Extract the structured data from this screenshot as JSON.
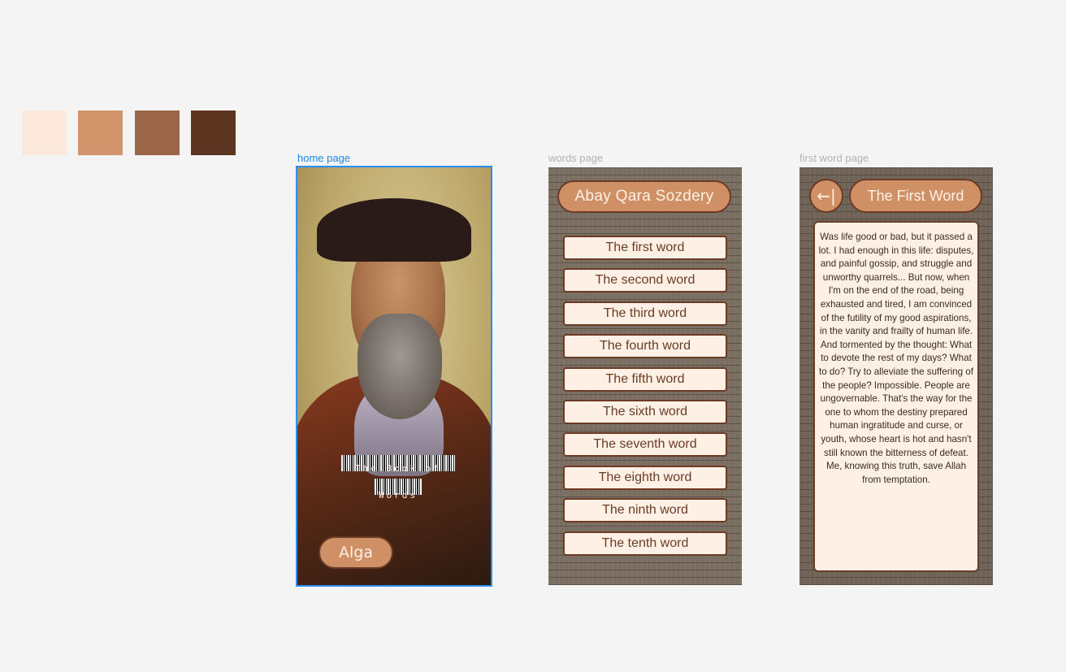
{
  "palette": {
    "colors": [
      "#fde9dc",
      "#d2956b",
      "#9b6548",
      "#5c3420"
    ]
  },
  "frames": {
    "home": {
      "label": "home page",
      "book_title_line1": "The Book of",
      "book_title_line2": "Words",
      "button_label": "Alga"
    },
    "words": {
      "label": "words page",
      "title": "Abay Qara Sozdery",
      "items": [
        "The first word",
        "The second word",
        "The third word",
        "The fourth word",
        "The fifth word",
        "The sixth word",
        "The seventh word",
        "The eighth word",
        "The ninth word",
        "The tenth word"
      ]
    },
    "first_word": {
      "label": "first word page",
      "back_icon": "←|",
      "title": "The First Word",
      "text": "Was life good or bad, but it passed a lot. I had enough in this life: disputes, and painful gossip, and struggle and unworthy quarrels... But now, when I'm on the end of the road, being exhausted and tired, I am convinced of the futility of my good aspirations, in the vanity and frailty of human life. And tormented by the thought: What to devote the rest of my days? What to do? Try to alleviate the suffering of the people? Impossible. People are ungovernable. That's the way for the one to whom the destiny prepared human ingratitude and curse, or youth, whose heart is hot and hasn't still known the bitterness of defeat. Me, knowing this truth, save Allah from temptation."
    }
  }
}
